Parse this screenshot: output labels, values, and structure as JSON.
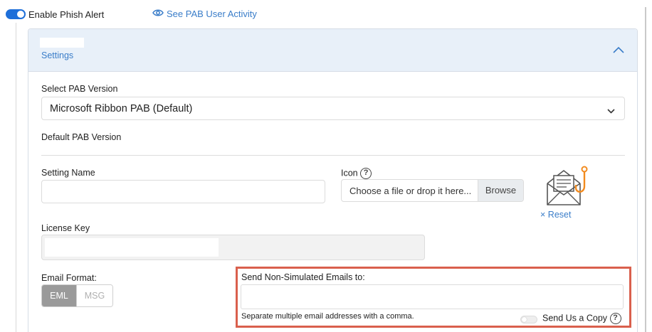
{
  "topbar": {
    "enable_label": "Enable Phish Alert",
    "enable_on": true,
    "activity_link": "See PAB User Activity"
  },
  "panel": {
    "title": "Settings"
  },
  "pab_version": {
    "label": "Select PAB Version",
    "selected": "Microsoft Ribbon PAB (Default)",
    "default_label": "Default PAB Version"
  },
  "setting_name": {
    "label": "Setting Name",
    "value": ""
  },
  "icon_field": {
    "label": "Icon",
    "file_placeholder": "Choose a file or drop it here...",
    "browse_label": "Browse",
    "reset_label": "Reset",
    "reset_icon": "×"
  },
  "license_key": {
    "label": "License Key"
  },
  "email_format": {
    "label": "Email Format:",
    "options": [
      "EML",
      "MSG"
    ],
    "selected": "EML"
  },
  "non_simulated": {
    "label": "Send Non-Simulated Emails to:",
    "value": "",
    "hint": "Separate multiple email addresses with a comma.",
    "copy_label": "Send Us a Copy",
    "copy_on": false
  },
  "help_glyph": "?",
  "colors": {
    "accent": "#1e6fd9",
    "link": "#3a7dc9",
    "header_bg": "#e8f0f9",
    "highlight_border": "#d9604d",
    "icon_orange": "#f28b1f"
  }
}
